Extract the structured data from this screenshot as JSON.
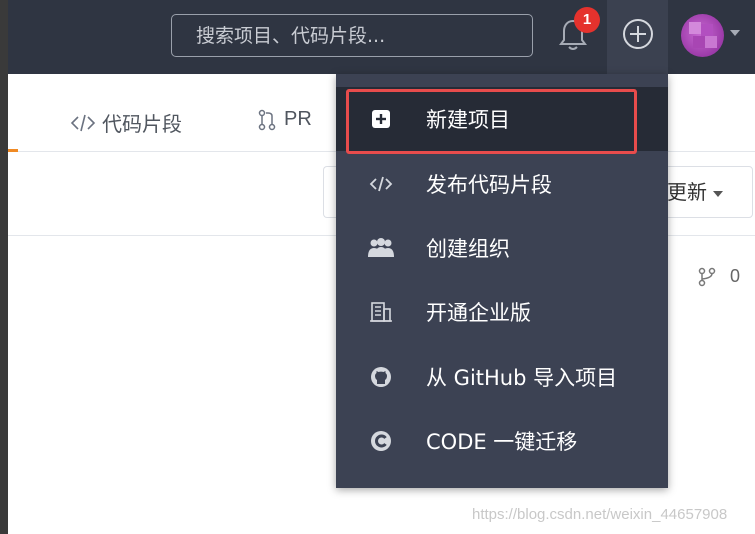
{
  "header": {
    "search_placeholder": "搜索项目、代码片段...",
    "notification_count": "1"
  },
  "subnav": {
    "tab_code": "代码片段",
    "tab_pr": "PR"
  },
  "filters": {
    "sort_label": "更新"
  },
  "repo": {
    "fork_count": "0"
  },
  "dropdown": {
    "items": [
      {
        "label": "新建项目",
        "icon": "plus-square-icon"
      },
      {
        "label": "发布代码片段",
        "icon": "code-icon"
      },
      {
        "label": "创建组织",
        "icon": "team-icon"
      },
      {
        "label": "开通企业版",
        "icon": "building-icon"
      },
      {
        "label": "从 GitHub 导入项目",
        "icon": "github-icon"
      },
      {
        "label": "CODE 一键迁移",
        "icon": "code-migrate-icon"
      }
    ]
  },
  "watermark": "https://blog.csdn.net/weixin_44657908",
  "colors": {
    "nav_bg": "#2f3542",
    "dropdown_bg": "#3c4253",
    "badge": "#e5322d",
    "highlight": "#e84c4c",
    "accent": "#f08a24"
  }
}
